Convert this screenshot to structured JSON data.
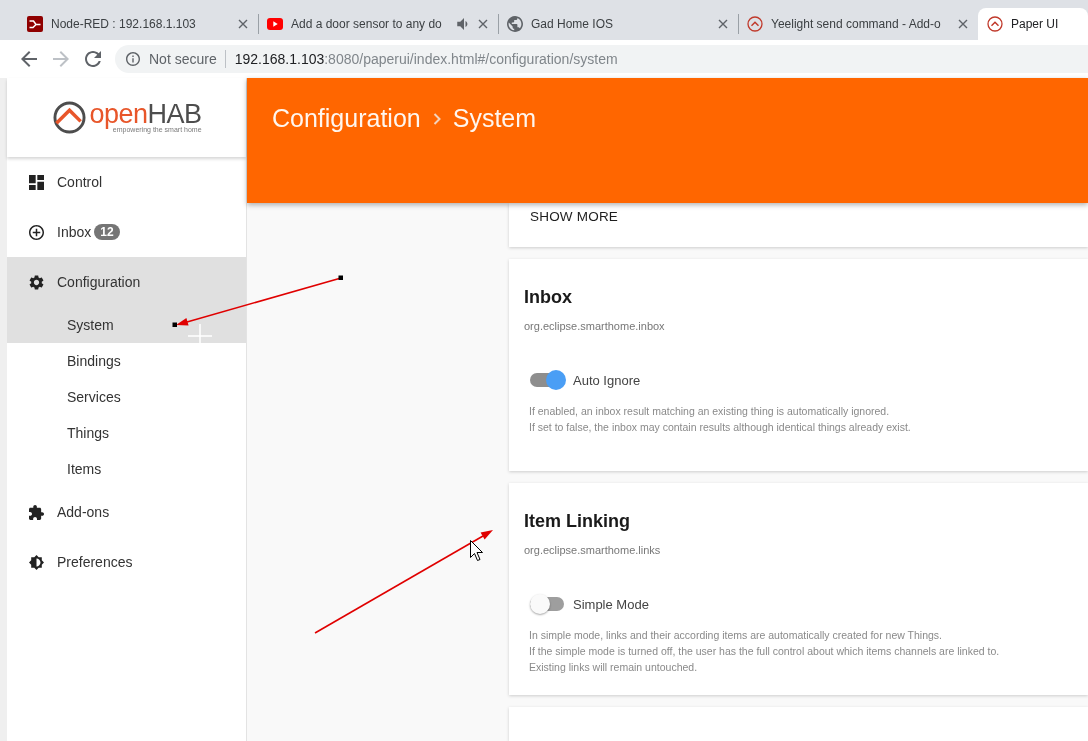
{
  "browser": {
    "tabs": [
      {
        "title": "Node-RED : 192.168.1.103",
        "selected": false,
        "audio": false
      },
      {
        "title": "Add a door sensor to any do",
        "selected": false,
        "audio": true
      },
      {
        "title": "Gad Home IOS",
        "selected": false,
        "audio": false
      },
      {
        "title": "Yeelight send command - Add-o",
        "selected": false,
        "audio": false
      },
      {
        "title": "Paper UI",
        "selected": true,
        "audio": false
      }
    ],
    "forward_button": {
      "disabled": true
    },
    "address_bar": {
      "security": "Not secure",
      "url_host": "192.168.1.103",
      "url_path": ":8080/paperui/index.html#/configuration/system"
    }
  },
  "sidebar": {
    "logo": {
      "wordmark": [
        "open",
        "HAB"
      ],
      "tagline": "empowering the smart home"
    },
    "items": [
      {
        "label": "Control",
        "selected": false
      },
      {
        "label": "Inbox",
        "badge": "12",
        "selected": false
      },
      {
        "label": "Configuration",
        "selected": true,
        "expanded": true,
        "children": [
          {
            "label": "System",
            "selected": true
          },
          {
            "label": "Bindings",
            "selected": false
          },
          {
            "label": "Services",
            "selected": false
          },
          {
            "label": "Things",
            "selected": false
          },
          {
            "label": "Items",
            "selected": false
          }
        ]
      },
      {
        "label": "Add-ons",
        "selected": false
      },
      {
        "label": "Preferences",
        "selected": false
      }
    ]
  },
  "header": {
    "breadcrumb": [
      "Configuration",
      "System"
    ]
  },
  "cards": [
    {
      "kind": "footer",
      "button": "SHOW MORE"
    },
    {
      "kind": "setting",
      "title": "Inbox",
      "subtitle": "org.eclipse.smarthome.inbox",
      "toggle": {
        "label": "Auto Ignore",
        "on": true
      },
      "description": [
        "If enabled, an inbox result matching an existing thing is automatically ignored.",
        "If set to false, the inbox may contain results although identical things already exist."
      ]
    },
    {
      "kind": "setting",
      "title": "Item Linking",
      "subtitle": "org.eclipse.smarthome.links",
      "toggle": {
        "label": "Simple Mode",
        "on": false
      },
      "description": [
        "In simple mode, links and their according items are automatically created for new Things.",
        "If the simple mode is turned off, the user has the full control about which items channels are linked to.",
        "Existing links will remain untouched."
      ]
    },
    {
      "kind": "blank"
    }
  ]
}
